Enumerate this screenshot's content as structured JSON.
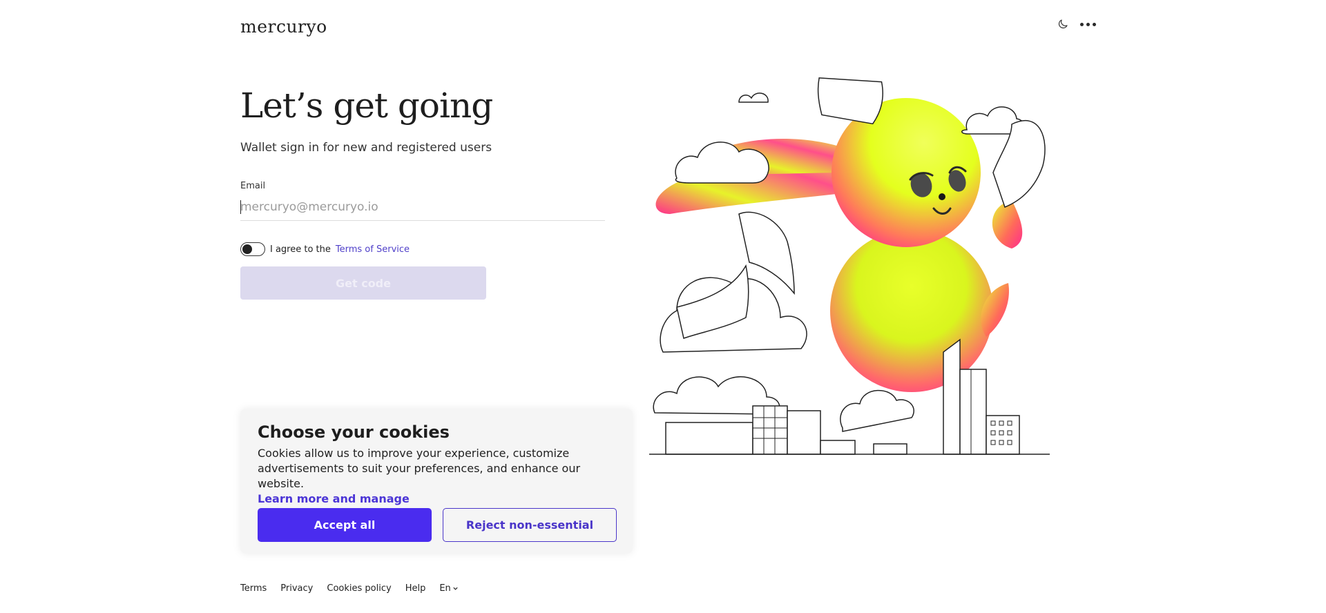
{
  "header": {
    "logo": "mercuryo",
    "theme_icon": "moon-icon",
    "more_icon": "more-dots-icon"
  },
  "main": {
    "heading": "Let’s get going",
    "subheading": "Wallet sign in for new and registered users",
    "email": {
      "label": "Email",
      "placeholder": "mercuryo@mercuryo.io",
      "value": ""
    },
    "agreement": {
      "prefix": "I agree to the",
      "link": "Terms of Service",
      "checked": false
    },
    "get_code_label": "Get code"
  },
  "cookie_banner": {
    "title": "Choose your cookies",
    "text": "Cookies allow us to improve your experience, customize advertisements to suit your preferences, and enhance our website.",
    "link": "Learn more and manage",
    "accept_label": "Accept all",
    "reject_label": "Reject non-essential"
  },
  "footer": {
    "links": [
      "Terms",
      "Privacy",
      "Cookies policy",
      "Help"
    ],
    "language": "En"
  },
  "colors": {
    "accent": "#4a2cef",
    "link": "#4f3fc9",
    "disabled_button": "#dcd9ee"
  }
}
